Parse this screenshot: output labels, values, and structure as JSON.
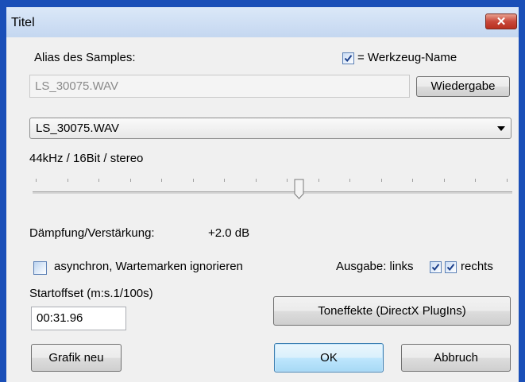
{
  "window": {
    "title": "Titel",
    "close_label": "x"
  },
  "alias": {
    "label": "Alias des Samples:",
    "value": "LS_30075.WAV",
    "tool_name_checkbox_label": "= Werkzeug-Name",
    "tool_name_checked": true
  },
  "buttons": {
    "play": "Wiedergabe",
    "effects": "Toneffekte (DirectX PlugIns)",
    "new_graphic": "Grafik neu",
    "ok": "OK",
    "cancel": "Abbruch"
  },
  "sample_select": {
    "selected": "LS_30075.WAV"
  },
  "format_info": "44kHz / 16Bit / stereo",
  "gain": {
    "label": "Dämpfung/Verstärkung:",
    "value": "+2.0 dB",
    "slider_fraction": 0.55
  },
  "async": {
    "label": "asynchron, Wartemarken ignorieren",
    "checked": false
  },
  "output": {
    "label": "Ausgabe: links",
    "left_checked": true,
    "right_checked": true,
    "right_label": "rechts"
  },
  "startoffset": {
    "label": "Startoffset (m:s.1/100s)",
    "value": "00:31.96"
  },
  "colors": {
    "frame": "#1a4fb8",
    "client": "#f0f0f0",
    "default_button": "#bee6fd"
  },
  "icons": {
    "close": "close-icon",
    "dropdown": "chevron-down-icon",
    "check": "check-icon"
  }
}
